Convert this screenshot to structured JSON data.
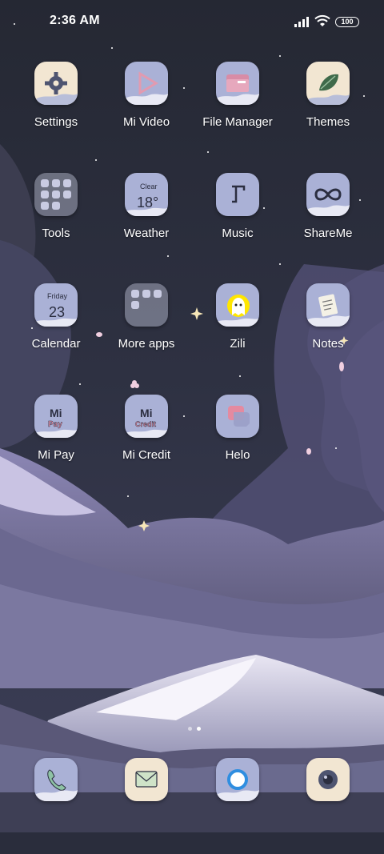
{
  "status_bar": {
    "time": "2:36 AM",
    "battery": "100",
    "icons": [
      "signal-icon",
      "wifi-icon",
      "battery-icon"
    ]
  },
  "apps": [
    {
      "label": "Settings",
      "icon": "gear-icon"
    },
    {
      "label": "Mi Video",
      "icon": "play-icon"
    },
    {
      "label": "File Manager",
      "icon": "folder-icon"
    },
    {
      "label": "Themes",
      "icon": "leaf-icon"
    },
    {
      "label": "Tools",
      "icon": "folder-icon"
    },
    {
      "label": "Weather",
      "icon": "weather-icon",
      "widget_condition": "Clear",
      "widget_temp": "18°"
    },
    {
      "label": "Music",
      "icon": "music-icon"
    },
    {
      "label": "ShareMe",
      "icon": "infinity-icon"
    },
    {
      "label": "Calendar",
      "icon": "calendar-icon",
      "widget_day": "Friday",
      "widget_date": "23"
    },
    {
      "label": "More apps",
      "icon": "folder-icon"
    },
    {
      "label": "Zili",
      "icon": "ghost-icon"
    },
    {
      "label": "Notes",
      "icon": "note-icon"
    },
    {
      "label": "Mi Pay",
      "icon": "mi-logo-icon",
      "badge": "Pay"
    },
    {
      "label": "Mi Credit",
      "icon": "mi-logo-icon",
      "badge": "Credit"
    },
    {
      "label": "Helo",
      "icon": "chat-bubble-icon"
    }
  ],
  "mi_logo": "Mi",
  "dock": [
    {
      "name": "phone",
      "icon": "phone-icon"
    },
    {
      "name": "messages",
      "icon": "envelope-icon"
    },
    {
      "name": "browser",
      "icon": "browser-icon"
    },
    {
      "name": "camera",
      "icon": "camera-icon"
    }
  ],
  "page_indicator": {
    "pages": 2,
    "current": 2
  },
  "colors": {
    "sky": "#2a2d3c",
    "icon_cream": "#f2e6d2",
    "icon_lavender": "#aab1d6",
    "zili_yellow": "#ffe600",
    "helo_pink": "#e48aa0"
  }
}
